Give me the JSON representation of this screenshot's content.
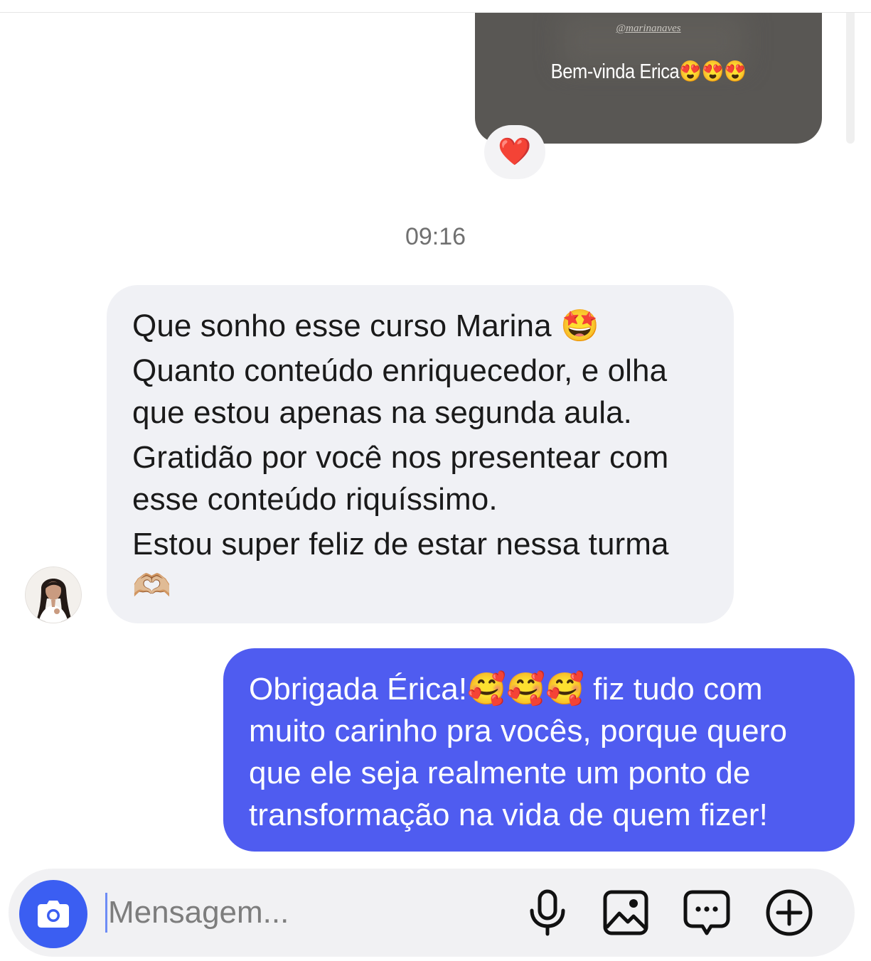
{
  "story": {
    "handle": "@marinanaves",
    "caption": "Bem-vinda Erica😍😍😍",
    "reaction": "❤️"
  },
  "thread": {
    "timestamp": "09:16",
    "incoming_lines": [
      "Que sonho esse curso Marina 🤩",
      "Quanto conteúdo enriquecedor, e olha",
      "que estou apenas na segunda aula.",
      "Gratidão por você nos presentear com",
      "esse conteúdo riquíssimo.",
      "Estou super feliz de estar nessa turma",
      "🫶🏼"
    ],
    "outgoing_lines": [
      "Obrigada Érica!🥰🥰🥰 fiz tudo com",
      "muito carinho pra vocês, porque quero",
      "que ele seja realmente um ponto de",
      "transformação na vida de quem fizer!"
    ]
  },
  "composer": {
    "placeholder": "Mensagem...",
    "icons": [
      "camera-icon",
      "microphone-icon",
      "image-icon",
      "sticker-chat-icon",
      "add-icon"
    ]
  },
  "colors": {
    "outgoing_bubble": "#4f5cf0",
    "incoming_bubble": "#f0f1f5",
    "camera_button": "#3b5ef2",
    "story_card": "#595754"
  }
}
